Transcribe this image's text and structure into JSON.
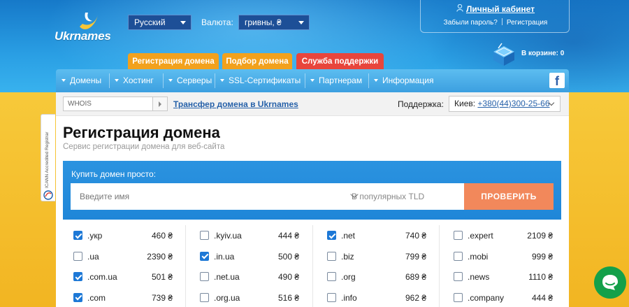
{
  "brand": {
    "name": "Ukrnames"
  },
  "header": {
    "language": "Русский",
    "currency_label": "Валюта:",
    "currency": "гривны, ₴",
    "account": {
      "link": "Личный кабинет",
      "forgot": "Забыли пароль?",
      "register": "Регистрация"
    },
    "cart": "В корзине: 0",
    "tabs": [
      "Регистрация домена",
      "Подбор домена",
      "Служба поддержки"
    ]
  },
  "nav": {
    "items": [
      "Домены",
      "Хостинг",
      "Серверы",
      "SSL-Сертификаты",
      "Партнерам",
      "Информация"
    ],
    "social": "f"
  },
  "subbar": {
    "whois_placeholder": "WHOIS",
    "transfer": "Трансфер домена в Ukrnames",
    "support_label": "Поддержка:",
    "city": "Киев:",
    "phone": "+380(44)300-25-66"
  },
  "main": {
    "title": "Регистрация домена",
    "subtitle": "Сервис регистрации домена для веб-сайта",
    "search": {
      "label": "Купить домен просто:",
      "placeholder": "Введите имя",
      "tld_select": "В популярных TLD",
      "button": "ПРОВЕРИТЬ"
    },
    "tld_columns": [
      [
        {
          "tld": ".укр",
          "price": "460 ₴",
          "checked": true
        },
        {
          "tld": ".ua",
          "price": "2390 ₴",
          "checked": false
        },
        {
          "tld": ".com.ua",
          "price": "501 ₴",
          "checked": true
        },
        {
          "tld": ".com",
          "price": "739 ₴",
          "checked": true
        }
      ],
      [
        {
          "tld": ".kyiv.ua",
          "price": "444 ₴",
          "checked": false
        },
        {
          "tld": ".in.ua",
          "price": "500 ₴",
          "checked": true
        },
        {
          "tld": ".net.ua",
          "price": "490 ₴",
          "checked": false
        },
        {
          "tld": ".org.ua",
          "price": "516 ₴",
          "checked": false
        }
      ],
      [
        {
          "tld": ".net",
          "price": "740 ₴",
          "checked": true
        },
        {
          "tld": ".biz",
          "price": "799 ₴",
          "checked": false
        },
        {
          "tld": ".org",
          "price": "689 ₴",
          "checked": false
        },
        {
          "tld": ".info",
          "price": "962 ₴",
          "checked": false
        }
      ],
      [
        {
          "tld": ".expert",
          "price": "2109 ₴",
          "checked": false
        },
        {
          "tld": ".mobi",
          "price": "999 ₴",
          "checked": false
        },
        {
          "tld": ".news",
          "price": "1110 ₴",
          "checked": false
        },
        {
          "tld": ".company",
          "price": "444 ₴",
          "checked": false
        }
      ]
    ]
  },
  "icann_badge": "ICANN Accredited Registrar",
  "colors": {
    "accent_blue": "#1f86d8",
    "tab_orange": "#f2a11d",
    "tab_red": "#e8453c",
    "check_button": "#f2885b",
    "chat_green": "#14a04a",
    "link_blue": "#2661a9"
  },
  "icons": {
    "user": "user-icon",
    "cart": "cart-icon",
    "facebook": "facebook-icon",
    "chat": "chat-icon"
  }
}
